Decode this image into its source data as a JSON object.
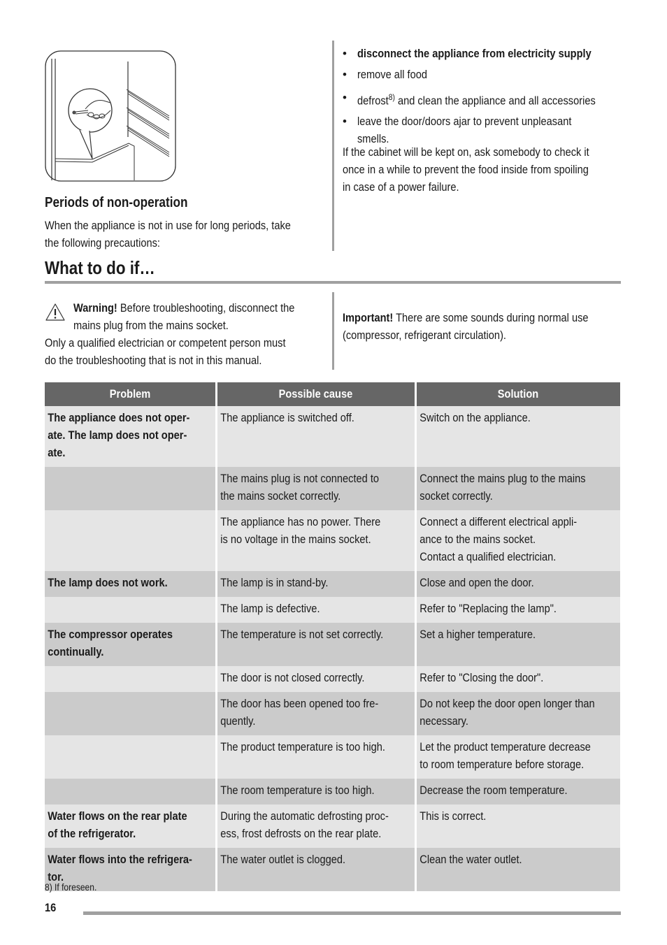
{
  "illustration": {
    "icon": "hand-adjusting-thermostat-illustration"
  },
  "non_operation": {
    "heading": "Periods of non-operation",
    "intro_lines": [
      "When the appliance is not in use for long periods, take",
      "the following precautions:"
    ],
    "bullets": [
      {
        "bold": "disconnect the appliance from electricity supply"
      },
      {
        "text": "remove all food"
      },
      {
        "text_before": "defrost",
        "sup": "8)",
        "text_after": " and clean the appliance and all accessories"
      },
      {
        "lines": [
          "leave the door/doors ajar to prevent unpleasant",
          "smells."
        ]
      }
    ],
    "after_lines": [
      "If the cabinet will be kept on, ask somebody to check it",
      "once in a while to prevent the food inside from spoiling",
      "in case of a power failure."
    ]
  },
  "what_to_do": {
    "heading": "What to do if…",
    "warning": {
      "icon": "warning-triangle-icon",
      "label": "Warning!",
      "line1_rest": " Before troubleshooting, disconnect the",
      "line2": "mains plug from the mains socket.",
      "lines_after": [
        "Only a qualified electrician or competent person must",
        "do the troubleshooting that is not in this manual."
      ]
    },
    "important": {
      "label": "Important!",
      "line1_rest": " There are some sounds during normal use",
      "line2": "(compressor, refrigerant circulation)."
    }
  },
  "table": {
    "headers": [
      "Problem",
      "Possible cause",
      "Solution"
    ],
    "rows": [
      {
        "problem": [
          "The appliance does not oper-",
          "ate. The lamp does not oper-",
          "ate."
        ],
        "cause": [
          "The appliance is switched off."
        ],
        "solution": [
          "Switch on the appliance."
        ]
      },
      {
        "problem": [],
        "cause": [
          "The mains plug is not connected to",
          "the mains socket correctly."
        ],
        "solution": [
          "Connect the mains plug to the mains",
          "socket correctly."
        ]
      },
      {
        "problem": [],
        "cause": [
          "The appliance has no power. There",
          "is no voltage in the mains socket."
        ],
        "solution": [
          "Connect a different electrical appli-",
          "ance to the mains socket.",
          "Contact a qualified electrician."
        ]
      },
      {
        "problem": [
          "The lamp does not work."
        ],
        "cause": [
          "The lamp is in stand-by."
        ],
        "solution": [
          "Close and open the door."
        ]
      },
      {
        "problem": [],
        "cause": [
          "The lamp is defective."
        ],
        "solution": [
          "Refer to \"Replacing the lamp\"."
        ]
      },
      {
        "problem": [
          "The compressor operates",
          "continually."
        ],
        "cause": [
          "The temperature is not set correctly."
        ],
        "solution": [
          "Set a higher temperature."
        ]
      },
      {
        "problem": [],
        "cause": [
          "The door is not closed correctly."
        ],
        "solution": [
          "Refer to \"Closing the door\"."
        ]
      },
      {
        "problem": [],
        "cause": [
          "The door has been opened too fre-",
          "quently."
        ],
        "solution": [
          "Do not keep the door open longer than",
          "necessary."
        ]
      },
      {
        "problem": [],
        "cause": [
          "The product temperature is too high."
        ],
        "solution": [
          "Let the product temperature decrease",
          "to room temperature before storage."
        ]
      },
      {
        "problem": [],
        "cause": [
          "The room temperature is too high."
        ],
        "solution": [
          "Decrease the room temperature."
        ]
      },
      {
        "problem": [
          "Water flows on the rear plate",
          "of the refrigerator."
        ],
        "cause": [
          "During the automatic defrosting proc-",
          "ess, frost defrosts on the rear plate."
        ],
        "solution": [
          "This is correct."
        ]
      },
      {
        "problem": [
          "Water flows into the refrigera-",
          "tor."
        ],
        "cause": [
          "The water outlet is clogged."
        ],
        "solution": [
          "Clean the water outlet."
        ]
      }
    ],
    "row_shading": [
      "light",
      "dark",
      "light",
      "dark",
      "light",
      "dark",
      "light",
      "dark",
      "light",
      "dark",
      "light",
      "dark"
    ],
    "colors": {
      "header_bg": "#666666",
      "row_light": "#e5e5e5",
      "row_dark": "#cbcbcb"
    }
  },
  "footer": {
    "footnote": "8) If foreseen.",
    "page_number": "16"
  }
}
